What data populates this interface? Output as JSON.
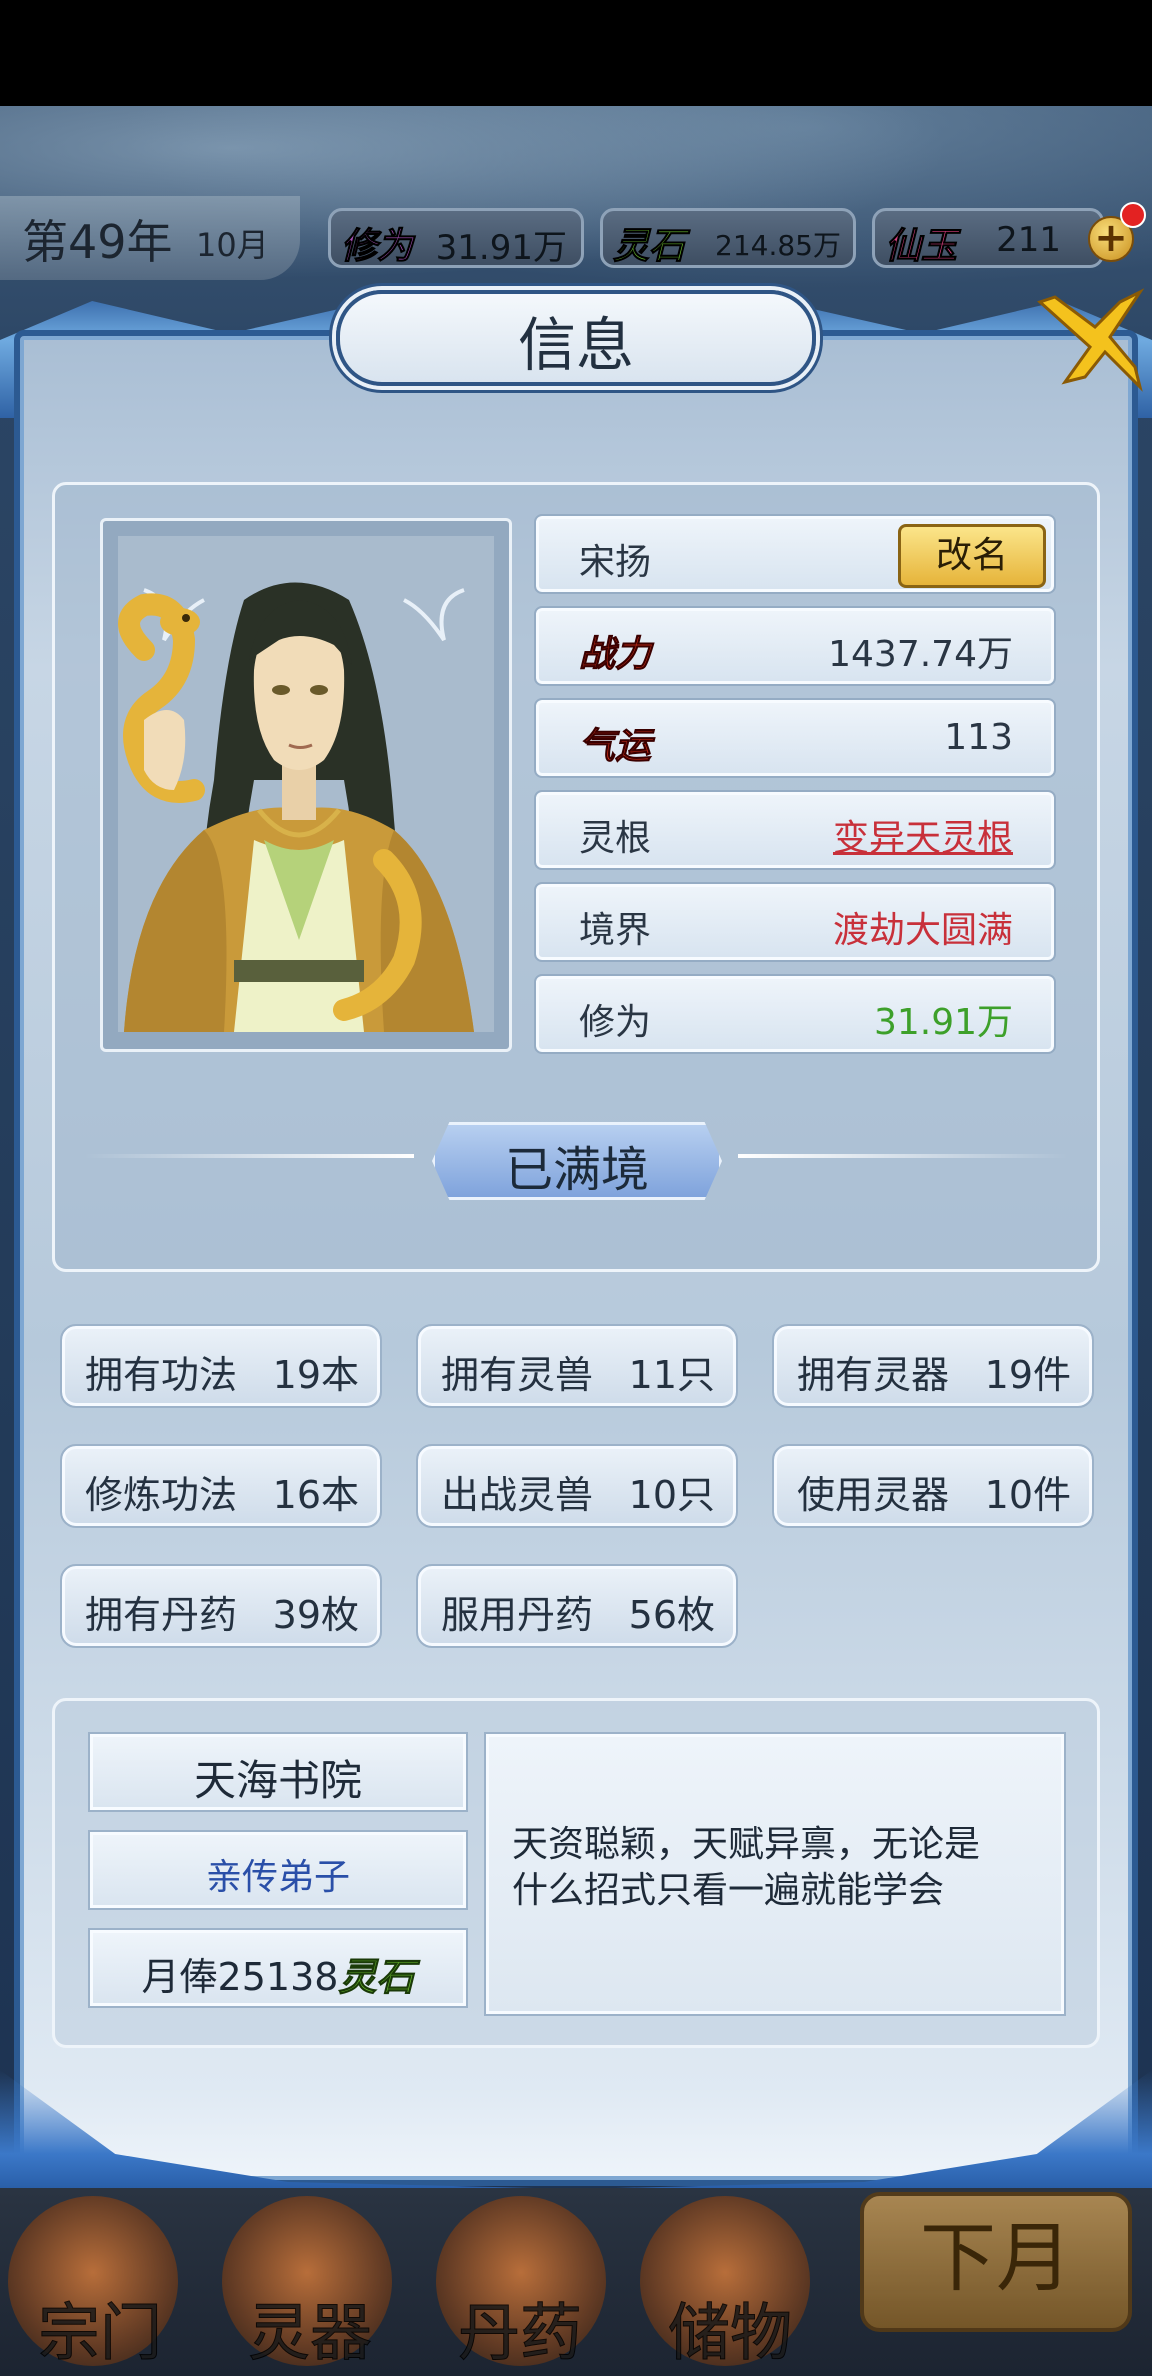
{
  "hud": {
    "year": "第49年",
    "month": "10月",
    "resources": [
      {
        "name": "修为",
        "value": "31.91万",
        "color": "#7a3a8a"
      },
      {
        "name": "灵石",
        "value": "214.85万",
        "color": "#4a8a2a"
      },
      {
        "name": "仙玉",
        "value": "211",
        "color": "#b02a5a"
      }
    ]
  },
  "dialog": {
    "title": "信息"
  },
  "character": {
    "name": "宋扬",
    "rename_label": "改名",
    "stats": [
      {
        "label": "战力",
        "value": "1437.74万",
        "fancy": true,
        "label_color": "#d0301a",
        "value_color": "#2a3644"
      },
      {
        "label": "气运",
        "value": "113",
        "fancy": true,
        "label_color": "#d0301a",
        "value_color": "#2a3644"
      },
      {
        "label": "灵根",
        "value": "变异天灵根",
        "fancy": false,
        "label_color": "#2a3644",
        "value_color": "#c8303a"
      },
      {
        "label": "境界",
        "value": "渡劫大圆满",
        "fancy": false,
        "label_color": "#2a3644",
        "value_color": "#c8303a"
      },
      {
        "label": "修为",
        "value": "31.91万",
        "fancy": false,
        "label_color": "#2a3644",
        "value_color": "#3da02a"
      }
    ],
    "realm_status": "已满境"
  },
  "counts": [
    {
      "label": "拥有功法",
      "value": "19本"
    },
    {
      "label": "拥有灵兽",
      "value": "11只"
    },
    {
      "label": "拥有灵器",
      "value": "19件"
    },
    {
      "label": "修炼功法",
      "value": "16本"
    },
    {
      "label": "出战灵兽",
      "value": "10只"
    },
    {
      "label": "使用灵器",
      "value": "10件"
    },
    {
      "label": "拥有丹药",
      "value": "39枚"
    },
    {
      "label": "服用丹药",
      "value": "56枚"
    }
  ],
  "sect": {
    "name": "天海书院",
    "rank": "亲传弟子",
    "salary_prefix": "月俸25138",
    "salary_unit": "灵石",
    "description_line1": "天资聪颖，天赋异禀，无论是",
    "description_line2": "什么招式只看一遍就能学会"
  },
  "bottom_nav": {
    "items": [
      "宗门",
      "灵器",
      "丹药",
      "储物"
    ],
    "next_month": "下月"
  },
  "colors": {
    "dialog_border": "#2c5a92",
    "rename_button": "#f0c850",
    "realm_badge": "#8fb0e6"
  }
}
